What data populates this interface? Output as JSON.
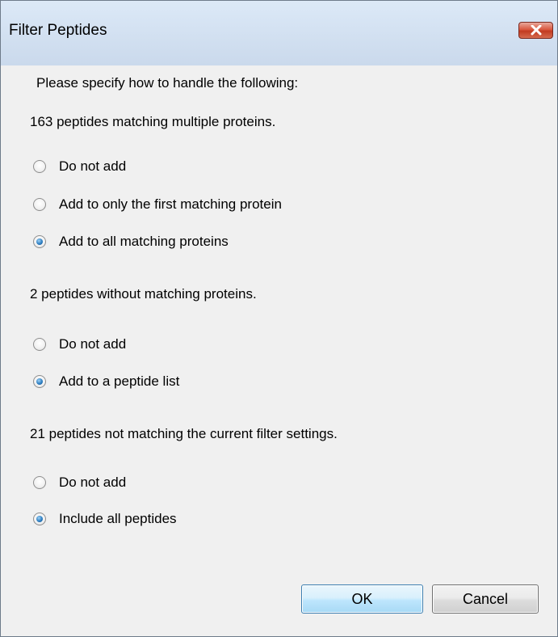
{
  "window": {
    "title": "Filter Peptides"
  },
  "intro": "Please specify how to handle the following:",
  "groups": [
    {
      "heading": "163 peptides matching multiple proteins.",
      "options": [
        {
          "label": "Do not add",
          "checked": false
        },
        {
          "label": "Add to only the first matching protein",
          "checked": false
        },
        {
          "label": "Add to all matching proteins",
          "checked": true
        }
      ]
    },
    {
      "heading": "2 peptides without matching proteins.",
      "options": [
        {
          "label": "Do not add",
          "checked": false
        },
        {
          "label": "Add to a peptide list",
          "checked": true
        }
      ]
    },
    {
      "heading": "21 peptides not matching the current filter settings.",
      "options": [
        {
          "label": "Do not add",
          "checked": false
        },
        {
          "label": "Include all peptides",
          "checked": true
        }
      ]
    }
  ],
  "buttons": {
    "ok": "OK",
    "cancel": "Cancel"
  },
  "icons": {
    "close": "close-icon",
    "radio_unchecked": "radio-unchecked-icon",
    "radio_checked": "radio-checked-icon"
  },
  "colors": {
    "title_bar": "#cad9ec",
    "close_button": "#c8442a",
    "radio_selected": "#2f7fc2",
    "ok_border": "#3c7fb1"
  }
}
